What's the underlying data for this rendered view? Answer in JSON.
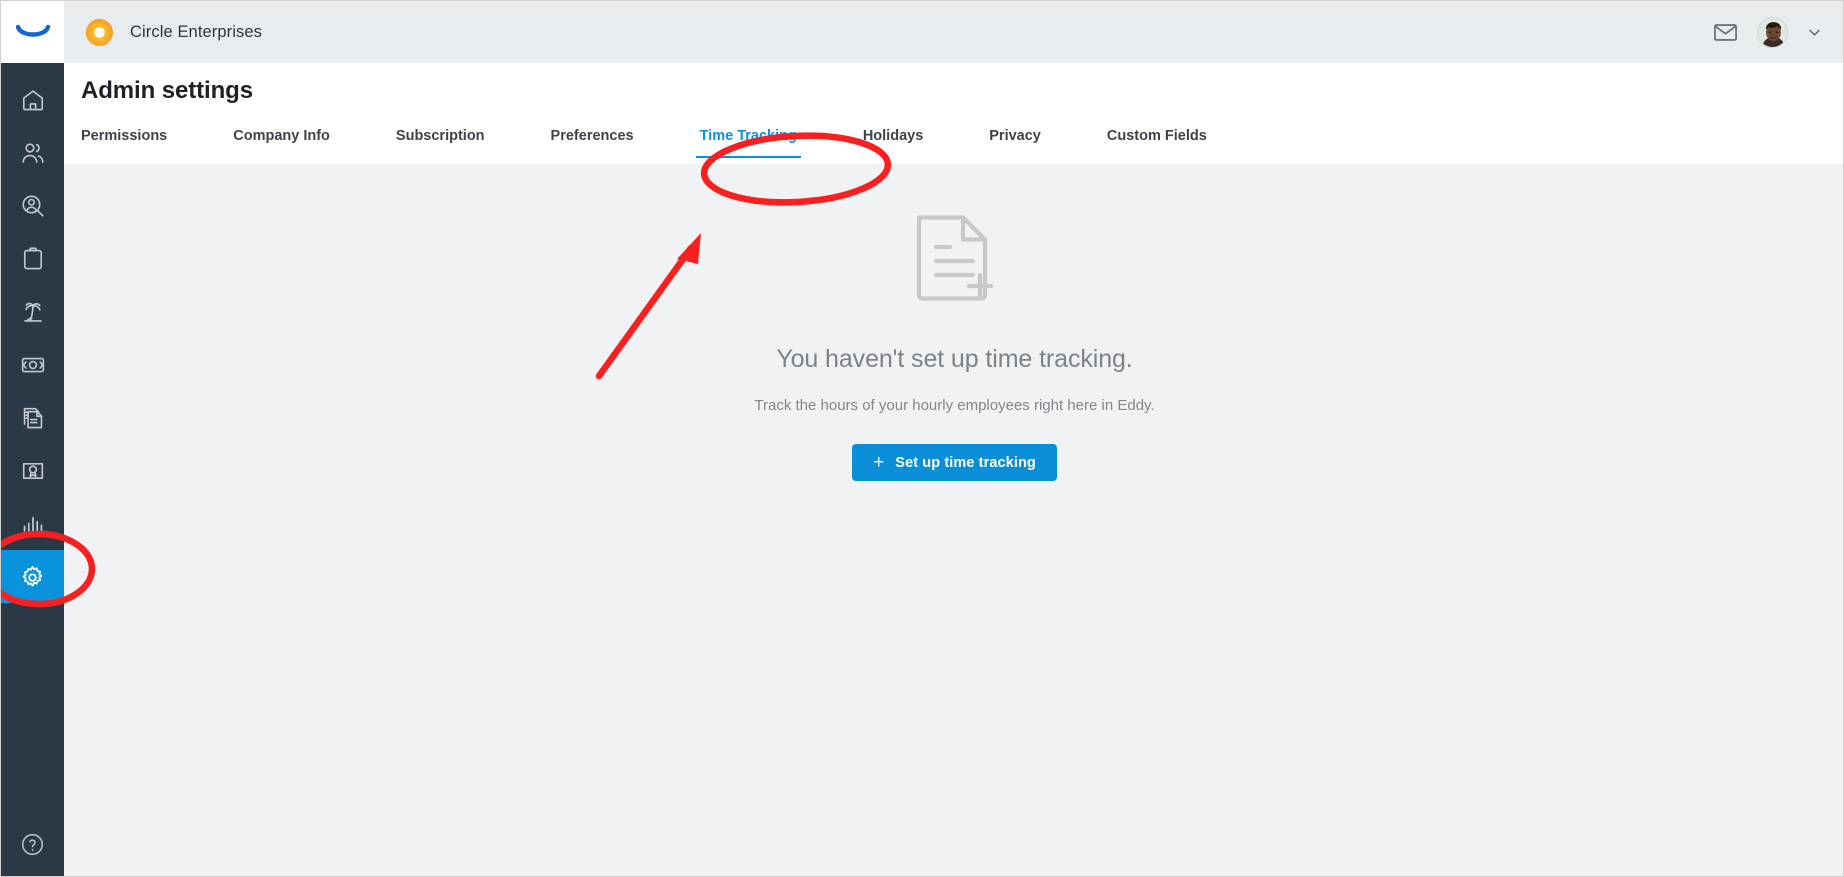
{
  "topbar": {
    "company_logo_icon": "orange-donut-logo",
    "company_name": "Circle Enterprises",
    "mail_icon": "envelope-icon",
    "avatar_icon": "user-avatar",
    "chevron_icon": "chevron-down-icon"
  },
  "sidebar": {
    "brand_icon": "eddy-smile-logo",
    "items": [
      {
        "name": "home",
        "icon": "home-icon",
        "active": false
      },
      {
        "name": "people",
        "icon": "people-icon",
        "active": false
      },
      {
        "name": "recruiting",
        "icon": "person-search-icon",
        "active": false
      },
      {
        "name": "onboarding",
        "icon": "clipboard-icon",
        "active": false
      },
      {
        "name": "time-off",
        "icon": "palm-tree-icon",
        "active": false
      },
      {
        "name": "payroll",
        "icon": "cash-icon",
        "active": false
      },
      {
        "name": "documents",
        "icon": "documents-icon",
        "active": false
      },
      {
        "name": "training",
        "icon": "certificate-icon",
        "active": false
      },
      {
        "name": "reports",
        "icon": "bar-chart-icon",
        "active": false
      },
      {
        "name": "settings",
        "icon": "gear-icon",
        "active": true
      }
    ],
    "help_icon": "question-mark-icon"
  },
  "header": {
    "title": "Admin settings"
  },
  "tabs": [
    {
      "label": "Permissions",
      "active": false
    },
    {
      "label": "Company Info",
      "active": false
    },
    {
      "label": "Subscription",
      "active": false
    },
    {
      "label": "Preferences",
      "active": false
    },
    {
      "label": "Time Tracking",
      "active": true
    },
    {
      "label": "Holidays",
      "active": false
    },
    {
      "label": "Privacy",
      "active": false
    },
    {
      "label": "Custom Fields",
      "active": false
    }
  ],
  "empty_state": {
    "icon": "document-add-icon",
    "title": "You haven't set up time tracking.",
    "subtitle": "Track the hours of your hourly employees right here in Eddy.",
    "button_label": "Set up time tracking",
    "button_icon": "plus-icon"
  },
  "annotations": {
    "color": "#f81f1f",
    "ellipse_tab": "red-ellipse-around-time-tracking-tab",
    "ellipse_gear": "red-ellipse-around-settings-icon",
    "arrow": "red-arrow-pointing-to-time-tracking-tab"
  },
  "colors": {
    "accent": "#0a93dd",
    "sidebar": "#2b3947",
    "topbar": "#e9ecef",
    "canvas": "#f1f2f4",
    "annotation": "#f81f1f"
  }
}
